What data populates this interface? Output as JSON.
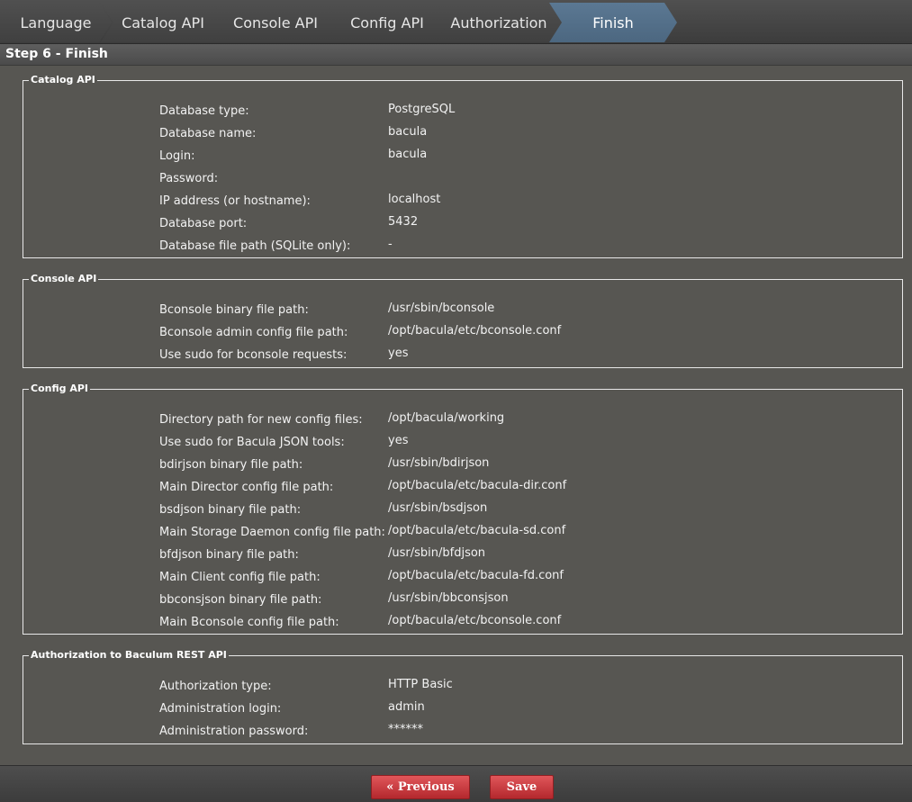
{
  "wizard": {
    "steps": [
      "Language",
      "Catalog API",
      "Console API",
      "Config API",
      "Authorization",
      "Finish"
    ],
    "active_step": "Finish"
  },
  "page_title": "Step 6 - Finish",
  "sections": {
    "catalog": {
      "legend": "Catalog API",
      "rows": [
        {
          "label": "Database type:",
          "value": "PostgreSQL"
        },
        {
          "label": "Database name:",
          "value": "bacula"
        },
        {
          "label": "Login:",
          "value": "bacula"
        },
        {
          "label": "Password:",
          "value": ""
        },
        {
          "label": "IP address (or hostname):",
          "value": "localhost"
        },
        {
          "label": "Database port:",
          "value": "5432"
        },
        {
          "label": "Database file path (SQLite only):",
          "value": "-"
        }
      ]
    },
    "console": {
      "legend": "Console API",
      "rows": [
        {
          "label": "Bconsole binary file path:",
          "value": "/usr/sbin/bconsole"
        },
        {
          "label": "Bconsole admin config file path:",
          "value": "/opt/bacula/etc/bconsole.conf"
        },
        {
          "label": "Use sudo for bconsole requests:",
          "value": "yes"
        }
      ]
    },
    "config": {
      "legend": "Config API",
      "rows": [
        {
          "label": "Directory path for new config files:",
          "value": "/opt/bacula/working"
        },
        {
          "label": "Use sudo for Bacula JSON tools:",
          "value": "yes"
        },
        {
          "label": "bdirjson binary file path:",
          "value": "/usr/sbin/bdirjson"
        },
        {
          "label": "Main Director config file path:",
          "value": "/opt/bacula/etc/bacula-dir.conf"
        },
        {
          "label": "bsdjson binary file path:",
          "value": "/usr/sbin/bsdjson"
        },
        {
          "label": "Main Storage Daemon config file path:",
          "value": "/opt/bacula/etc/bacula-sd.conf"
        },
        {
          "label": "bfdjson binary file path:",
          "value": "/usr/sbin/bfdjson"
        },
        {
          "label": "Main Client config file path:",
          "value": "/opt/bacula/etc/bacula-fd.conf"
        },
        {
          "label": "bbconsjson binary file path:",
          "value": "/usr/sbin/bbconsjson"
        },
        {
          "label": "Main Bconsole config file path:",
          "value": "/opt/bacula/etc/bconsole.conf"
        }
      ]
    },
    "auth": {
      "legend": "Authorization to Baculum REST API",
      "rows": [
        {
          "label": "Authorization type:",
          "value": "HTTP Basic"
        },
        {
          "label": "Administration login:",
          "value": "admin"
        },
        {
          "label": "Administration password:",
          "value": "******"
        }
      ]
    }
  },
  "footer": {
    "previous_label": "« Previous",
    "save_label": "Save"
  },
  "colors": {
    "active_step": "#5b7893",
    "button": "#c93a3e",
    "content_bg": "#575652"
  }
}
